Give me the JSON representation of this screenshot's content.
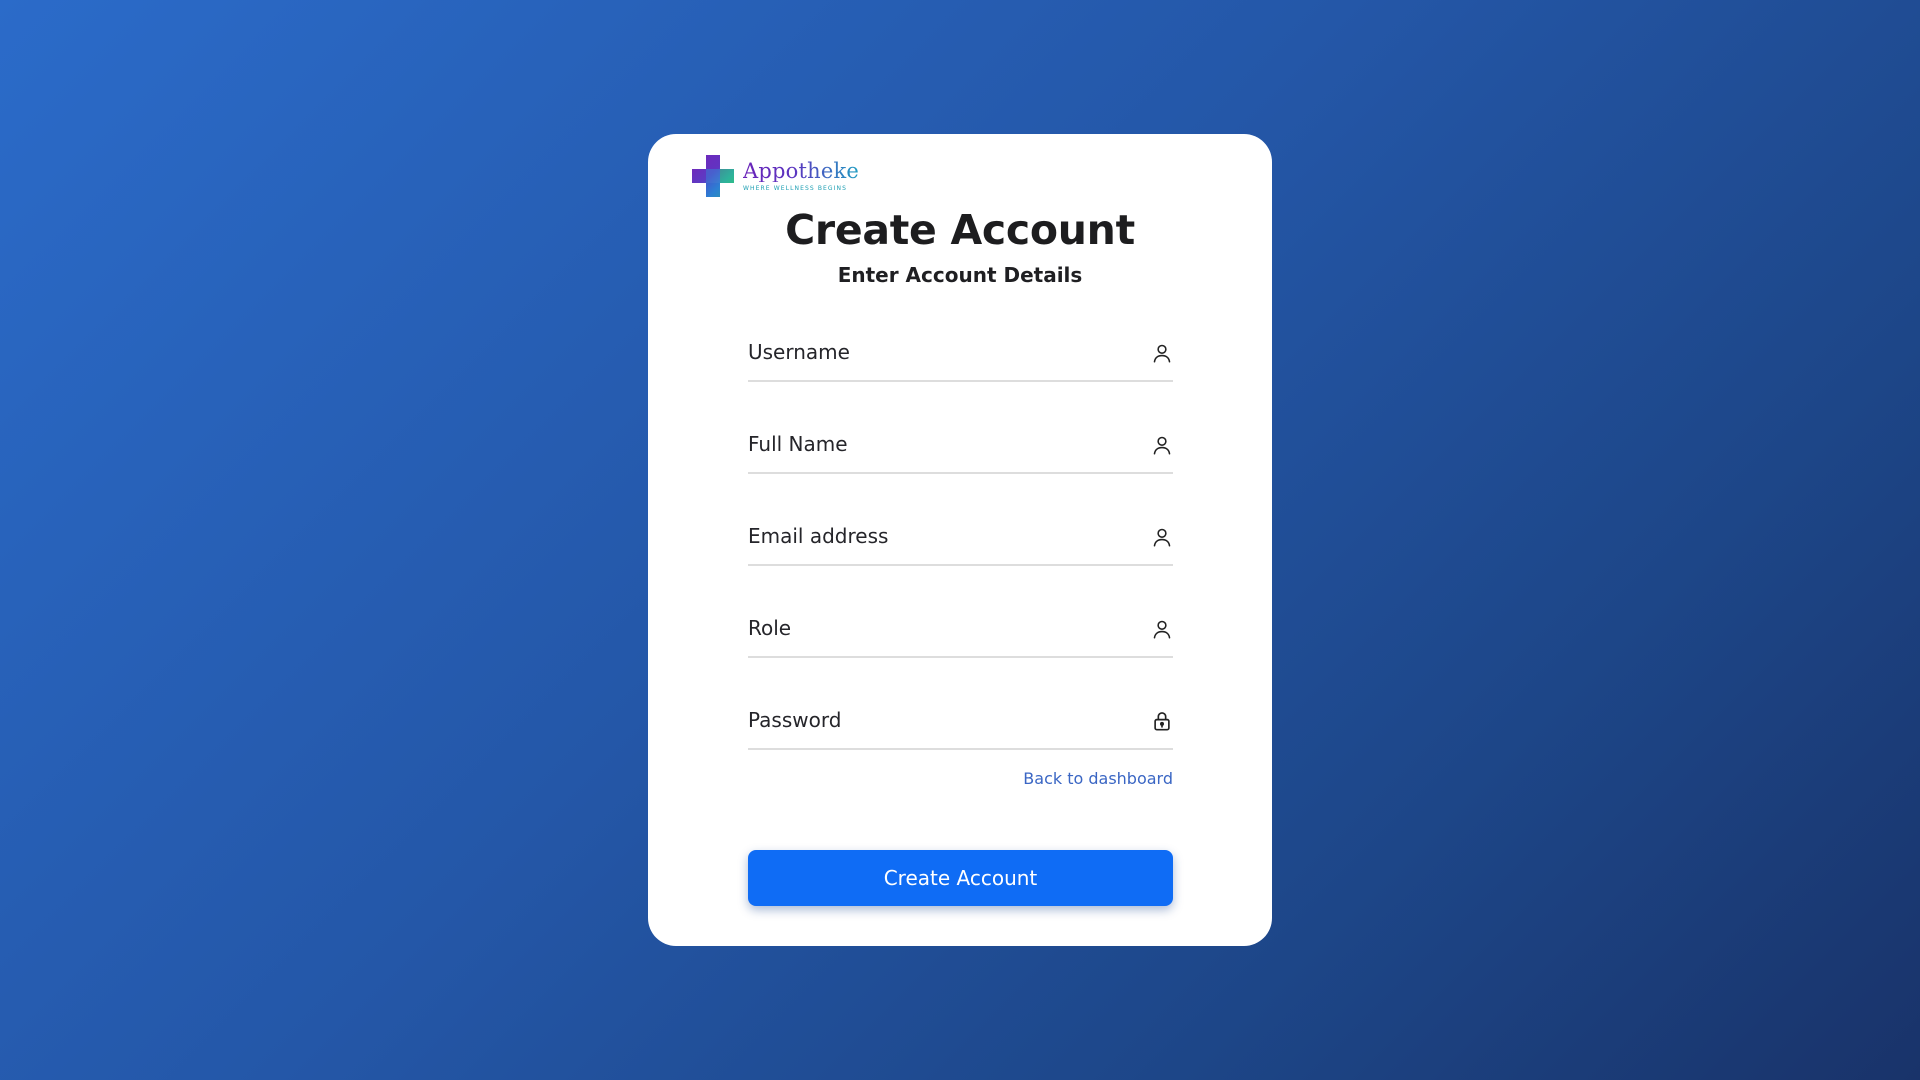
{
  "brand": {
    "name": "Appotheke",
    "tagline": "WHERE WELLNESS BEGINS",
    "colors": {
      "purple": "#6a22b8",
      "teal": "#1f9ec2",
      "green": "#2ecc71"
    }
  },
  "page": {
    "title": "Create Account",
    "subtitle": "Enter Account Details"
  },
  "form": {
    "fields": [
      {
        "placeholder": "Username",
        "value": "",
        "icon": "user-icon"
      },
      {
        "placeholder": "Full Name",
        "value": "",
        "icon": "user-icon"
      },
      {
        "placeholder": "Email address",
        "value": "",
        "icon": "user-icon"
      },
      {
        "placeholder": "Role",
        "value": "",
        "icon": "user-icon"
      },
      {
        "placeholder": "Password",
        "value": "",
        "icon": "lock-icon"
      }
    ],
    "back_link": "Back to dashboard",
    "submit_label": "Create Account"
  },
  "colors": {
    "accent": "#0f6cf5",
    "link": "#3a66c4",
    "background_start": "#2b6bc9",
    "background_end": "#19336a"
  }
}
